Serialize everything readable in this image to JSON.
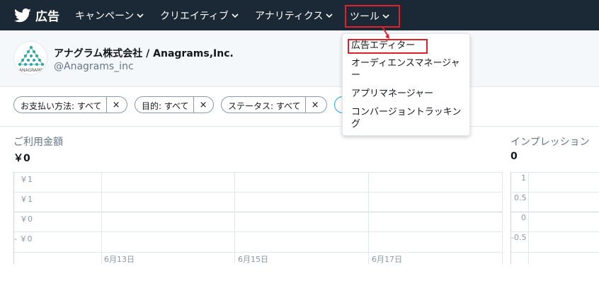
{
  "nav": {
    "brand": "広告",
    "items": [
      {
        "label": "キャンペーン"
      },
      {
        "label": "クリエイティブ"
      },
      {
        "label": "アナリティクス"
      },
      {
        "label": "ツール"
      }
    ]
  },
  "account": {
    "name": "アナグラム株式会社 / Anagrams,Inc.",
    "handle": "@Anagrams_inc",
    "logo_text": "ANAGRAMS"
  },
  "filters": [
    {
      "label": "お支払い方法: すべて",
      "remove": "×"
    },
    {
      "label": "目的: すべて",
      "remove": "×"
    },
    {
      "label": "ステータス: すべて",
      "remove": "×"
    }
  ],
  "metrics": {
    "spend": {
      "label": "ご利用金額",
      "value": "￥0"
    },
    "impressions": {
      "label": "インプレッション",
      "value": "0"
    }
  },
  "spend_chart": {
    "y_ticks": [
      "￥1",
      "￥1",
      "￥0",
      "- ￥0"
    ],
    "x_ticks": [
      "6月13日",
      "6月15日",
      "6月17日"
    ]
  },
  "impressions_chart": {
    "y_ticks": [
      "1",
      "0.5",
      "0",
      "-0.5"
    ]
  },
  "tools_menu": {
    "items": [
      "広告エディター",
      "オーディエンスマネージャー",
      "アプリマネージャー",
      "コンバージョントラッキング"
    ]
  },
  "colors": {
    "nav_bg": "#1b2835",
    "highlight": "#e0202a",
    "accent": "#1da1f2"
  }
}
